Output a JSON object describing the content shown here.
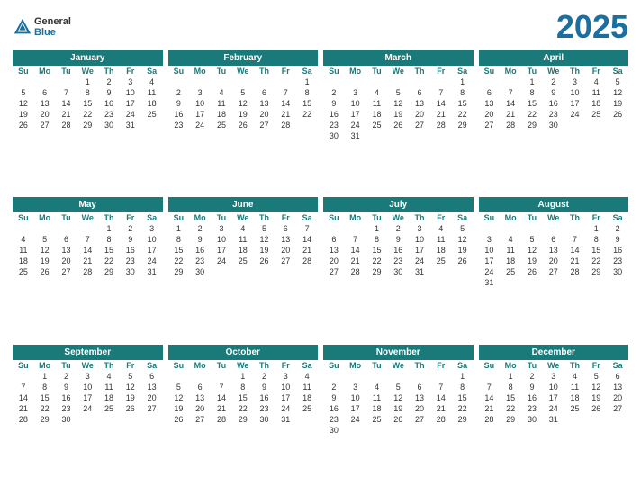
{
  "header": {
    "logo_line1": "General",
    "logo_line2": "Blue",
    "year": "2025"
  },
  "months": [
    {
      "name": "January",
      "days_header": [
        "Su",
        "Mo",
        "Tu",
        "We",
        "Th",
        "Fr",
        "Sa"
      ],
      "weeks": [
        [
          "",
          "",
          "",
          "1",
          "2",
          "3",
          "4"
        ],
        [
          "5",
          "6",
          "7",
          "8",
          "9",
          "10",
          "11"
        ],
        [
          "12",
          "13",
          "14",
          "15",
          "16",
          "17",
          "18"
        ],
        [
          "19",
          "20",
          "21",
          "22",
          "23",
          "24",
          "25"
        ],
        [
          "26",
          "27",
          "28",
          "29",
          "30",
          "31",
          ""
        ]
      ]
    },
    {
      "name": "February",
      "days_header": [
        "Su",
        "Mo",
        "Tu",
        "We",
        "Th",
        "Fr",
        "Sa"
      ],
      "weeks": [
        [
          "",
          "",
          "",
          "",
          "",
          "",
          "1"
        ],
        [
          "2",
          "3",
          "4",
          "5",
          "6",
          "7",
          "8"
        ],
        [
          "9",
          "10",
          "11",
          "12",
          "13",
          "14",
          "15"
        ],
        [
          "16",
          "17",
          "18",
          "19",
          "20",
          "21",
          "22"
        ],
        [
          "23",
          "24",
          "25",
          "26",
          "27",
          "28",
          ""
        ]
      ]
    },
    {
      "name": "March",
      "days_header": [
        "Su",
        "Mo",
        "Tu",
        "We",
        "Th",
        "Fr",
        "Sa"
      ],
      "weeks": [
        [
          "",
          "",
          "",
          "",
          "",
          "",
          "1"
        ],
        [
          "2",
          "3",
          "4",
          "5",
          "6",
          "7",
          "8"
        ],
        [
          "9",
          "10",
          "11",
          "12",
          "13",
          "14",
          "15"
        ],
        [
          "16",
          "17",
          "18",
          "19",
          "20",
          "21",
          "22"
        ],
        [
          "23",
          "24",
          "25",
          "26",
          "27",
          "28",
          "29"
        ],
        [
          "30",
          "31",
          "",
          "",
          "",
          "",
          ""
        ]
      ]
    },
    {
      "name": "April",
      "days_header": [
        "Su",
        "Mo",
        "Tu",
        "We",
        "Th",
        "Fr",
        "Sa"
      ],
      "weeks": [
        [
          "",
          "",
          "1",
          "2",
          "3",
          "4",
          "5"
        ],
        [
          "6",
          "7",
          "8",
          "9",
          "10",
          "11",
          "12"
        ],
        [
          "13",
          "14",
          "15",
          "16",
          "17",
          "18",
          "19"
        ],
        [
          "20",
          "21",
          "22",
          "23",
          "24",
          "25",
          "26"
        ],
        [
          "27",
          "28",
          "29",
          "30",
          "",
          "",
          ""
        ]
      ]
    },
    {
      "name": "May",
      "days_header": [
        "Su",
        "Mo",
        "Tu",
        "We",
        "Th",
        "Fr",
        "Sa"
      ],
      "weeks": [
        [
          "",
          "",
          "",
          "",
          "1",
          "2",
          "3"
        ],
        [
          "4",
          "5",
          "6",
          "7",
          "8",
          "9",
          "10"
        ],
        [
          "11",
          "12",
          "13",
          "14",
          "15",
          "16",
          "17"
        ],
        [
          "18",
          "19",
          "20",
          "21",
          "22",
          "23",
          "24"
        ],
        [
          "25",
          "26",
          "27",
          "28",
          "29",
          "30",
          "31"
        ]
      ]
    },
    {
      "name": "June",
      "days_header": [
        "Su",
        "Mo",
        "Tu",
        "We",
        "Th",
        "Fr",
        "Sa"
      ],
      "weeks": [
        [
          "1",
          "2",
          "3",
          "4",
          "5",
          "6",
          "7"
        ],
        [
          "8",
          "9",
          "10",
          "11",
          "12",
          "13",
          "14"
        ],
        [
          "15",
          "16",
          "17",
          "18",
          "19",
          "20",
          "21"
        ],
        [
          "22",
          "23",
          "24",
          "25",
          "26",
          "27",
          "28"
        ],
        [
          "29",
          "30",
          "",
          "",
          "",
          "",
          ""
        ]
      ]
    },
    {
      "name": "July",
      "days_header": [
        "Su",
        "Mo",
        "Tu",
        "We",
        "Th",
        "Fr",
        "Sa"
      ],
      "weeks": [
        [
          "",
          "",
          "1",
          "2",
          "3",
          "4",
          "5"
        ],
        [
          "6",
          "7",
          "8",
          "9",
          "10",
          "11",
          "12"
        ],
        [
          "13",
          "14",
          "15",
          "16",
          "17",
          "18",
          "19"
        ],
        [
          "20",
          "21",
          "22",
          "23",
          "24",
          "25",
          "26"
        ],
        [
          "27",
          "28",
          "29",
          "30",
          "31",
          "",
          ""
        ]
      ]
    },
    {
      "name": "August",
      "days_header": [
        "Su",
        "Mo",
        "Tu",
        "We",
        "Th",
        "Fr",
        "Sa"
      ],
      "weeks": [
        [
          "",
          "",
          "",
          "",
          "",
          "1",
          "2"
        ],
        [
          "3",
          "4",
          "5",
          "6",
          "7",
          "8",
          "9"
        ],
        [
          "10",
          "11",
          "12",
          "13",
          "14",
          "15",
          "16"
        ],
        [
          "17",
          "18",
          "19",
          "20",
          "21",
          "22",
          "23"
        ],
        [
          "24",
          "25",
          "26",
          "27",
          "28",
          "29",
          "30"
        ],
        [
          "31",
          "",
          "",
          "",
          "",
          "",
          ""
        ]
      ]
    },
    {
      "name": "September",
      "days_header": [
        "Su",
        "Mo",
        "Tu",
        "We",
        "Th",
        "Fr",
        "Sa"
      ],
      "weeks": [
        [
          "",
          "1",
          "2",
          "3",
          "4",
          "5",
          "6"
        ],
        [
          "7",
          "8",
          "9",
          "10",
          "11",
          "12",
          "13"
        ],
        [
          "14",
          "15",
          "16",
          "17",
          "18",
          "19",
          "20"
        ],
        [
          "21",
          "22",
          "23",
          "24",
          "25",
          "26",
          "27"
        ],
        [
          "28",
          "29",
          "30",
          "",
          "",
          "",
          ""
        ]
      ]
    },
    {
      "name": "October",
      "days_header": [
        "Su",
        "Mo",
        "Tu",
        "We",
        "Th",
        "Fr",
        "Sa"
      ],
      "weeks": [
        [
          "",
          "",
          "",
          "1",
          "2",
          "3",
          "4"
        ],
        [
          "5",
          "6",
          "7",
          "8",
          "9",
          "10",
          "11"
        ],
        [
          "12",
          "13",
          "14",
          "15",
          "16",
          "17",
          "18"
        ],
        [
          "19",
          "20",
          "21",
          "22",
          "23",
          "24",
          "25"
        ],
        [
          "26",
          "27",
          "28",
          "29",
          "30",
          "31",
          ""
        ]
      ]
    },
    {
      "name": "November",
      "days_header": [
        "Su",
        "Mo",
        "Tu",
        "We",
        "Th",
        "Fr",
        "Sa"
      ],
      "weeks": [
        [
          "",
          "",
          "",
          "",
          "",
          "",
          "1"
        ],
        [
          "2",
          "3",
          "4",
          "5",
          "6",
          "7",
          "8"
        ],
        [
          "9",
          "10",
          "11",
          "12",
          "13",
          "14",
          "15"
        ],
        [
          "16",
          "17",
          "18",
          "19",
          "20",
          "21",
          "22"
        ],
        [
          "23",
          "24",
          "25",
          "26",
          "27",
          "28",
          "29"
        ],
        [
          "30",
          "",
          "",
          "",
          "",
          "",
          ""
        ]
      ]
    },
    {
      "name": "December",
      "days_header": [
        "Su",
        "Mo",
        "Tu",
        "We",
        "Th",
        "Fr",
        "Sa"
      ],
      "weeks": [
        [
          "",
          "1",
          "2",
          "3",
          "4",
          "5",
          "6"
        ],
        [
          "7",
          "8",
          "9",
          "10",
          "11",
          "12",
          "13"
        ],
        [
          "14",
          "15",
          "16",
          "17",
          "18",
          "19",
          "20"
        ],
        [
          "21",
          "22",
          "23",
          "24",
          "25",
          "26",
          "27"
        ],
        [
          "28",
          "29",
          "30",
          "31",
          "",
          "",
          ""
        ]
      ]
    }
  ]
}
